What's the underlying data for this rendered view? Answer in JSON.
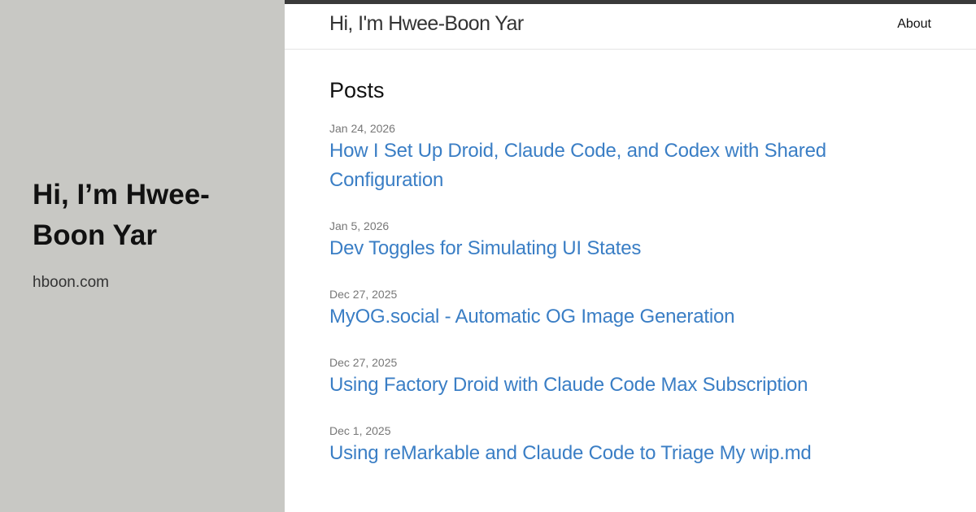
{
  "sidebar": {
    "title": "Hi, I’m Hwee-Boon Yar",
    "url": "hboon.com"
  },
  "header": {
    "site_title": "Hi, I'm Hwee-Boon Yar",
    "nav_about": "About"
  },
  "main": {
    "heading": "Posts",
    "posts": [
      {
        "date": "Jan 24, 2026",
        "title": "How I Set Up Droid, Claude Code, and Codex with Shared Configuration"
      },
      {
        "date": "Jan 5, 2026",
        "title": "Dev Toggles for Simulating UI States"
      },
      {
        "date": "Dec 27, 2025",
        "title": "MyOG.social - Automatic OG Image Generation"
      },
      {
        "date": "Dec 27, 2025",
        "title": "Using Factory Droid with Claude Code Max Subscription"
      },
      {
        "date": "Dec 1, 2025",
        "title": "Using reMarkable and Claude Code to Triage My wip.md"
      }
    ]
  },
  "colors": {
    "sidebar_bg": "#c8c8c4",
    "top_bar": "#3a3a3a",
    "link": "#3a7ec5",
    "date": "#777777"
  }
}
